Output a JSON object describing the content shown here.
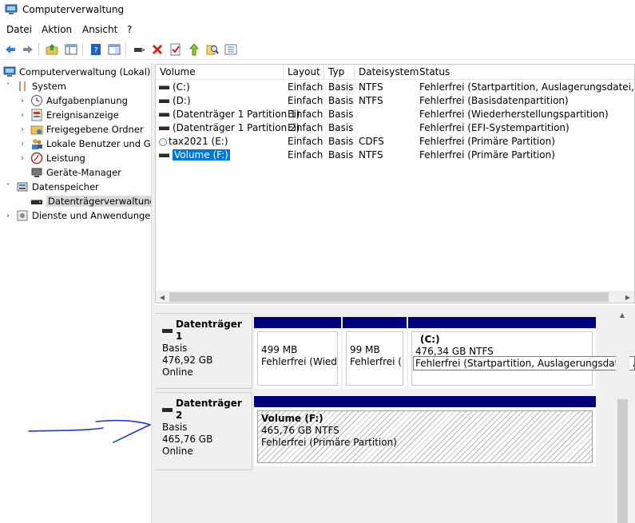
{
  "window": {
    "title": "Computerverwaltung"
  },
  "menu": [
    "Datei",
    "Aktion",
    "Ansicht",
    "?"
  ],
  "toolbar_icons": [
    "back-arrow-icon",
    "forward-arrow-icon",
    "up-folder-icon",
    "show-hide-tree-icon",
    "help-icon",
    "properties-icon",
    "connect-icon",
    "delete-icon",
    "checkmark-icon",
    "folder-up-icon",
    "search-icon",
    "list-icon"
  ],
  "tree": {
    "root": "Computerverwaltung (Lokal)",
    "system": "System",
    "aufgaben": "Aufgabenplanung",
    "ereignis": "Ereignisanzeige",
    "freigaben": "Freigegebene Ordner",
    "benutzer": "Lokale Benutzer und Gru",
    "leistung": "Leistung",
    "geraete": "Geräte-Manager",
    "datenspeicher": "Datenspeicher",
    "datentraeger": "Datenträgerverwaltung",
    "dienste": "Dienste und Anwendungen"
  },
  "columns": {
    "volume": "Volume",
    "layout": "Layout",
    "typ": "Typ",
    "fs": "Dateisystem",
    "status": "Status"
  },
  "volumes": [
    {
      "name": "(C:)",
      "layout": "Einfach",
      "typ": "Basis",
      "fs": "NTFS",
      "status": "Fehlerfrei (Startpartition, Auslagerungsdatei, Abstu"
    },
    {
      "name": "(D:)",
      "layout": "Einfach",
      "typ": "Basis",
      "fs": "NTFS",
      "status": "Fehlerfrei (Basisdatenpartition)"
    },
    {
      "name": "(Datenträger 1 Partition 1)",
      "layout": "Einfach",
      "typ": "Basis",
      "fs": "",
      "status": "Fehlerfrei (Wiederherstellungspartition)"
    },
    {
      "name": "(Datenträger 1 Partition 2)",
      "layout": "Einfach",
      "typ": "Basis",
      "fs": "",
      "status": "Fehlerfrei (EFI-Systempartition)"
    },
    {
      "name": "tax2021 (E:)",
      "layout": "Einfach",
      "typ": "Basis",
      "fs": "CDFS",
      "status": "Fehlerfrei (Primäre Partition)"
    },
    {
      "name": "Volume (F:)",
      "layout": "Einfach",
      "typ": "Basis",
      "fs": "NTFS",
      "status": "Fehlerfrei (Primäre Partition)"
    }
  ],
  "disks": [
    {
      "name": "Datenträger 1",
      "type": "Basis",
      "size": "476,92 GB",
      "state": "Online",
      "partitions": [
        {
          "title": "",
          "size": "499 MB",
          "status": "Fehlerfrei (Wiederl"
        },
        {
          "title": "",
          "size": "99 MB",
          "status": "Fehlerfrei (EF"
        },
        {
          "title": "(C:)",
          "size": "476,34 GB NTFS",
          "status": "Fehlerfrei (Startpartition, Auslagerungsdatei, Absturz"
        }
      ]
    },
    {
      "name": "Datenträger 2",
      "type": "Basis",
      "size": "465,76 GB",
      "state": "Online",
      "partitions": [
        {
          "title": "Volume  (F:)",
          "size": "465,76 GB NTFS",
          "status": "Fehlerfrei (Primäre Partition)"
        }
      ]
    }
  ]
}
